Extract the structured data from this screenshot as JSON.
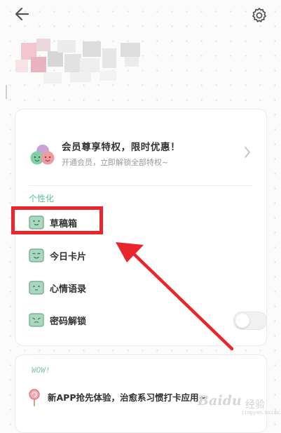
{
  "header": {
    "back_icon": "arrow-left-icon",
    "settings_icon": "gear-icon"
  },
  "vip_banner": {
    "title": "会员尊享特权，限时优惠！",
    "subtitle": "开通会员，立即解锁全部特权~",
    "icon": "smiley-balloons-icon"
  },
  "section": {
    "label": "个性化"
  },
  "menu": {
    "items": [
      {
        "label": "草稿箱",
        "icon": "face-box-icon"
      },
      {
        "label": "今日卡片",
        "icon": "face-box-icon"
      },
      {
        "label": "心情语录",
        "icon": "face-box-icon"
      },
      {
        "label": "密码解锁",
        "icon": "face-box-icon"
      }
    ],
    "password_toggle_on": false
  },
  "promo": {
    "tag": "WOW!",
    "text": "新APP抢先体验，治愈系习惯打卡应用~",
    "icon": "lollipop-icon"
  },
  "watermark": {
    "brand": "Baidu",
    "sub": "经验",
    "url": "jingyan.baidu.com"
  },
  "colors": {
    "accent_green": "#5cbf95",
    "annotation_red": "#e8262b",
    "face_fill": "#a9d8bf",
    "face_stroke": "#6aa58a"
  }
}
